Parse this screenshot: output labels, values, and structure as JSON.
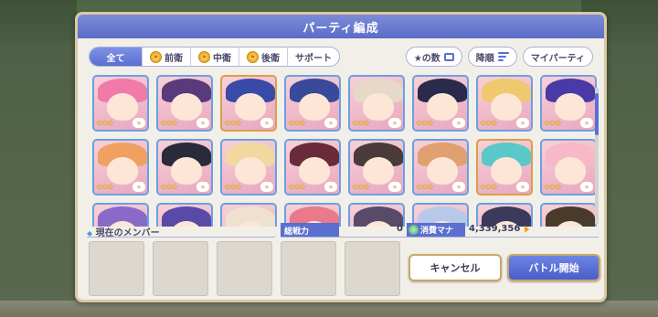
{
  "dialog": {
    "title": "パーティ編成"
  },
  "tabs": [
    {
      "label": "全て",
      "active": true,
      "icon": ""
    },
    {
      "label": "前衛",
      "active": false,
      "icon": "»"
    },
    {
      "label": "中衛",
      "active": false,
      "icon": "»"
    },
    {
      "label": "後衛",
      "active": false,
      "icon": "»"
    },
    {
      "label": "サポート",
      "active": false,
      "icon": ""
    }
  ],
  "controls": {
    "sort_label": "★の数",
    "order_label": "降順",
    "my_party_label": "マイパーティ"
  },
  "members": {
    "current_label": "現在のメンバー",
    "power_label": "総戦力",
    "power_value": "0",
    "mana_label": "消費マナ",
    "mana_value": "4,339,356"
  },
  "buttons": {
    "cancel": "キャンセル",
    "start": "バトル開始"
  },
  "characters": [
    {
      "stars": "★★★",
      "frame": "blue",
      "hair": "#f07aa8"
    },
    {
      "stars": "★★★",
      "frame": "blue",
      "hair": "#5a3a7a"
    },
    {
      "stars": "★★★",
      "frame": "gold",
      "hair": "#3a4aa8"
    },
    {
      "stars": "★★★",
      "frame": "blue",
      "hair": "#3a4a9a"
    },
    {
      "stars": "★★★",
      "frame": "blue",
      "hair": "#e8d8c8"
    },
    {
      "stars": "★★★",
      "frame": "blue",
      "hair": "#2a2a4a"
    },
    {
      "stars": "★★★",
      "frame": "blue",
      "hair": "#f0c870"
    },
    {
      "stars": "★★★",
      "frame": "blue",
      "hair": "#4a3aa8"
    },
    {
      "stars": "★★★",
      "frame": "blue",
      "hair": "#f0a060"
    },
    {
      "stars": "★★★",
      "frame": "blue",
      "hair": "#2a2a3a"
    },
    {
      "stars": "★★★",
      "frame": "blue",
      "hair": "#f0d8a0"
    },
    {
      "stars": "★★★",
      "frame": "blue",
      "hair": "#6a2a3a"
    },
    {
      "stars": "★★★",
      "frame": "blue",
      "hair": "#4a3a3a"
    },
    {
      "stars": "★★★",
      "frame": "blue",
      "hair": "#e0a070"
    },
    {
      "stars": "★★★",
      "frame": "gold",
      "hair": "#5ac8c8"
    },
    {
      "stars": "★★★",
      "frame": "blue",
      "hair": "#f8b8c8"
    },
    {
      "stars": "",
      "frame": "blue",
      "hair": "#8a6ac8"
    },
    {
      "stars": "",
      "frame": "blue",
      "hair": "#5a4aa8"
    },
    {
      "stars": "",
      "frame": "blue",
      "hair": "#f0e0d0"
    },
    {
      "stars": "",
      "frame": "blue",
      "hair": "#e87a8a"
    },
    {
      "stars": "",
      "frame": "blue",
      "hair": "#5a4a6a"
    },
    {
      "stars": "",
      "frame": "blue",
      "hair": "#b8c8e8"
    },
    {
      "stars": "",
      "frame": "blue",
      "hair": "#3a3a5a"
    },
    {
      "stars": "",
      "frame": "blue",
      "hair": "#4a3a2a"
    }
  ],
  "member_slot_count": 5
}
